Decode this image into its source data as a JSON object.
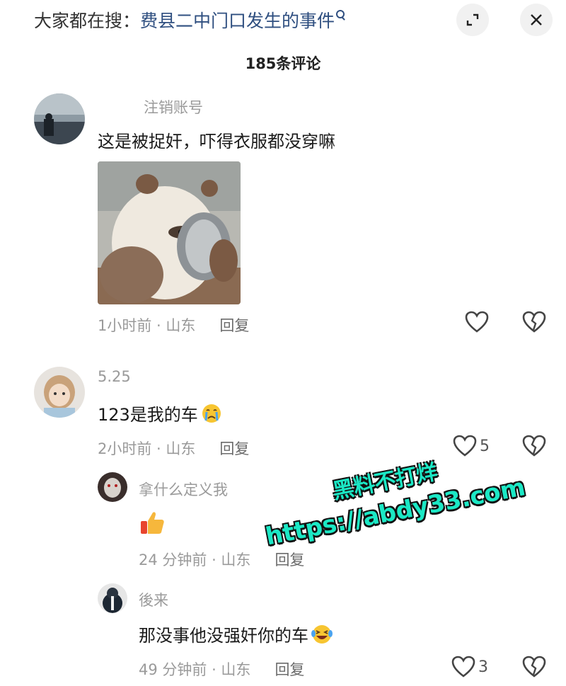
{
  "header": {
    "search_prefix": "大家都在搜：",
    "search_term": "费县二中门口发生的事件",
    "expand_icon": "expand-icon",
    "close_icon": "close-icon"
  },
  "comment_count": "185条评论",
  "comments": [
    {
      "username": "注销账号",
      "text": "这是被捉奸，吓得衣服都没穿嘛",
      "image": "panda-with-pot-image",
      "time_location": "1小时前 · 山东",
      "reply_label": "回复",
      "likes": ""
    },
    {
      "username": "5.25",
      "text": "123是我的车",
      "emoji": "crying-face-emoji",
      "time_location": "2小时前 · 山东",
      "reply_label": "回复",
      "likes": "5"
    }
  ],
  "replies": [
    {
      "username": "拿什么定义我",
      "emoji": "thumbs-up-emoji",
      "time_location": "24 分钟前 · 山东",
      "reply_label": "回复"
    },
    {
      "username": "後来",
      "text": "那没事他没强奸你的车",
      "emoji": "laughing-tears-emoji",
      "time_location": "49 分钟前 · 山东",
      "reply_label": "回复",
      "likes": "3"
    }
  ],
  "watermark": {
    "line1": "黑料不打烊",
    "line2": "https://abdy33.com"
  },
  "colors": {
    "accent_link": "#2f4f80",
    "muted_text": "#9a9a9a",
    "watermark": "#1be8c5"
  }
}
